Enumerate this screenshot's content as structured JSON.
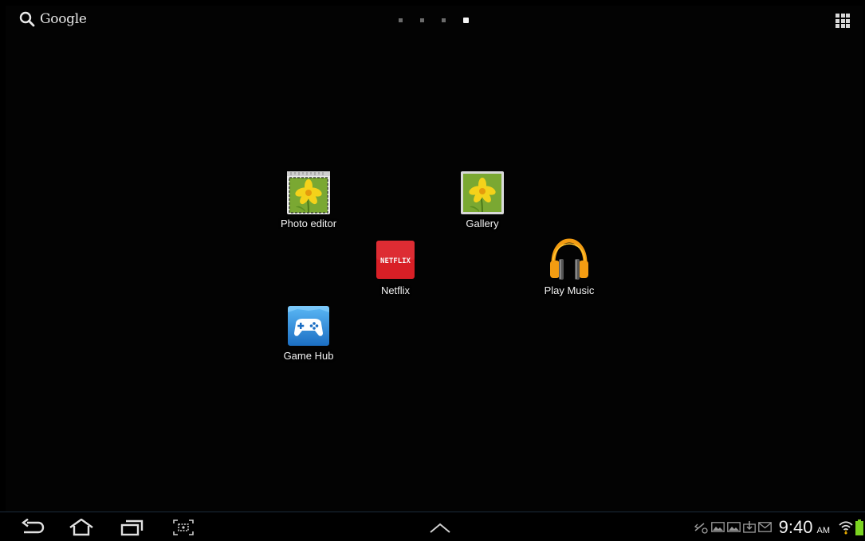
{
  "top_bar": {
    "search_label": "Google",
    "page_count": 4,
    "active_page_index": 3
  },
  "shortcuts": [
    {
      "label": "Photo editor",
      "icon": "photo-editor-icon"
    },
    {
      "label": "Gallery",
      "icon": "gallery-icon"
    },
    {
      "label": "Netflix",
      "icon": "netflix-icon",
      "icon_text": "NETFLIX"
    },
    {
      "label": "Play Music",
      "icon": "play-music-icon"
    },
    {
      "label": "Game Hub",
      "icon": "game-hub-icon"
    }
  ],
  "nav_bar": {
    "buttons": [
      "back-icon",
      "home-icon",
      "recent-apps-icon",
      "screenshot-icon"
    ],
    "center": "chevron-up-icon"
  },
  "status_bar": {
    "icons": [
      "usb-debug-icon",
      "image-notification-icon",
      "image-notification-icon",
      "download-notification-icon",
      "email-icon",
      "wifi-icon",
      "battery-icon"
    ],
    "time": "9:40",
    "ampm": "AM",
    "battery_color": "#7bd321"
  },
  "colors": {
    "background": "#000000",
    "netflix_red": "#d81f26",
    "gallery_green": "#7aa832",
    "music_orange": "#f39c12",
    "game_hub_blue": "#2d8fdc"
  }
}
